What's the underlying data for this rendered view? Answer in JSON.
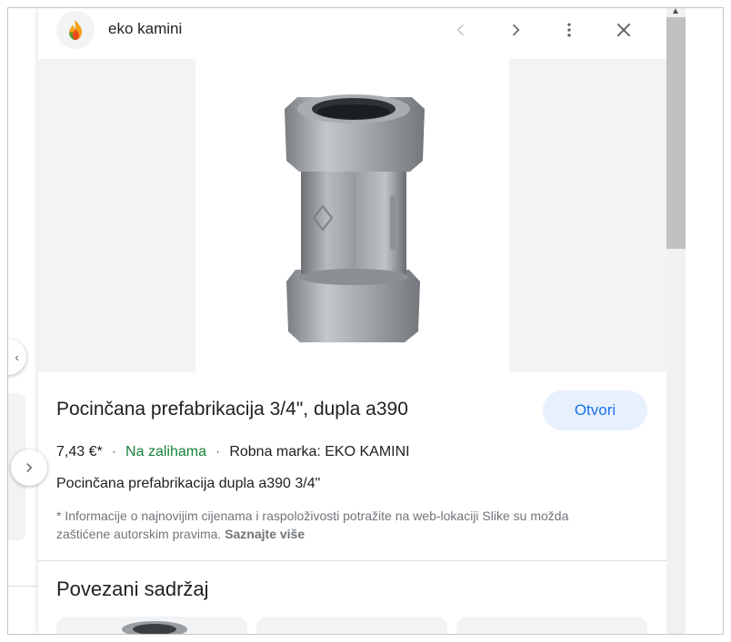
{
  "header": {
    "site_name": "eko kamini",
    "logo_icon": "flame-logo-icon",
    "prev_icon": "chevron-left-icon",
    "next_icon": "chevron-right-icon",
    "more_icon": "more-vert-icon",
    "close_icon": "close-icon"
  },
  "product": {
    "image_alt": "galvanized-pipe-coupling-image",
    "title": "Pocinčana prefabrikacija 3/4\", dupla a390",
    "open_label": "Otvori",
    "price": "7,43 €*",
    "stock": "Na zalihama",
    "brand": "Robna marka: EKO KAMINI",
    "subtitle": "Pocinčana prefabrikacija dupla a390 3/4\"",
    "disclaimer": "* Informacije o najnovijim cijenama i raspoloživosti potražite na web-lokaciji Slike su možda zaštićene autorskim pravima.",
    "learn_more": "Saznajte više"
  },
  "related": {
    "title": "Povezani sadržaj"
  },
  "colors": {
    "accent": "#1a73e8",
    "accent_bg": "#e8f0fe",
    "stock_green": "#188038",
    "muted": "#70757a"
  }
}
